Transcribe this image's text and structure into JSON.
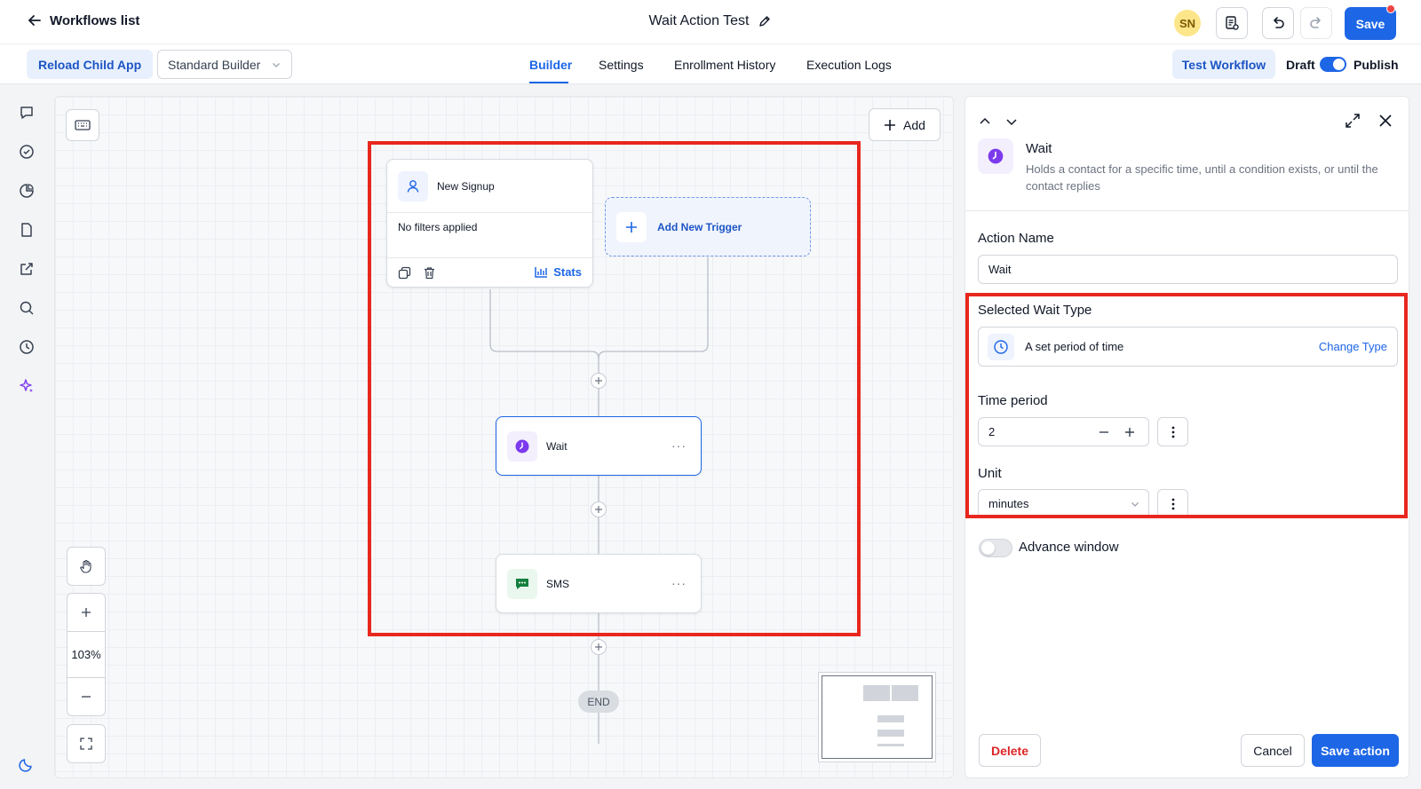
{
  "header": {
    "back_label": "Workflows list",
    "title": "Wait Action Test",
    "avatar_initials": "SN",
    "save_label": "Save"
  },
  "toolbar": {
    "reload_label": "Reload Child App",
    "builder_select": "Standard Builder",
    "tabs": [
      "Builder",
      "Settings",
      "Enrollment History",
      "Execution Logs"
    ],
    "active_tab": "Builder",
    "test_label": "Test Workflow",
    "draft_label": "Draft",
    "publish_label": "Publish",
    "publish_toggle_on": true
  },
  "rail": {
    "icons": [
      "chat-icon",
      "check-circle-icon",
      "pie-chart-icon",
      "file-icon",
      "external-link-icon",
      "search-icon",
      "history-icon",
      "sparkle-icon",
      "moon-icon"
    ]
  },
  "canvas": {
    "add_label": "Add",
    "zoom_level": "103%",
    "trigger": {
      "title": "New Signup",
      "filters": "No filters applied",
      "stats_label": "Stats"
    },
    "add_trigger_label": "Add New Trigger",
    "actions": [
      {
        "label": "Wait",
        "icon": "clock-icon",
        "color": "#7c3aed"
      },
      {
        "label": "SMS",
        "icon": "message-icon",
        "color": "#15803d"
      }
    ],
    "end_label": "END"
  },
  "panel": {
    "title": "Wait",
    "description": "Holds a contact for a specific time, until a condition exists, or until the contact replies",
    "action_name_label": "Action Name",
    "action_name_value": "Wait",
    "wait_type_label": "Selected Wait Type",
    "wait_type_value": "A set period of time",
    "change_type_label": "Change Type",
    "time_period_label": "Time period",
    "time_period_value": "2",
    "unit_label": "Unit",
    "unit_value": "minutes",
    "advance_window_label": "Advance window",
    "advance_window_on": false,
    "delete_label": "Delete",
    "cancel_label": "Cancel",
    "save_action_label": "Save action"
  },
  "colors": {
    "primary": "#1d66e6",
    "highlight": "#e8271e",
    "danger": "#dc2626"
  }
}
